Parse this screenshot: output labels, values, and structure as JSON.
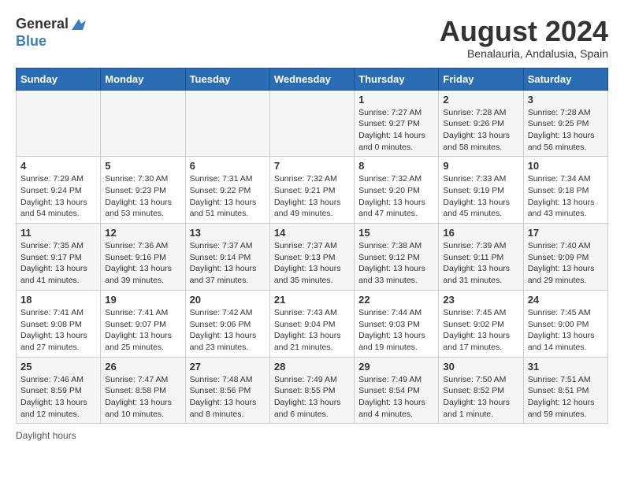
{
  "logo": {
    "line1": "General",
    "line2": "Blue"
  },
  "title": "August 2024",
  "location": "Benalauria, Andalusia, Spain",
  "days_header": [
    "Sunday",
    "Monday",
    "Tuesday",
    "Wednesday",
    "Thursday",
    "Friday",
    "Saturday"
  ],
  "weeks": [
    [
      {
        "day": "",
        "detail": ""
      },
      {
        "day": "",
        "detail": ""
      },
      {
        "day": "",
        "detail": ""
      },
      {
        "day": "",
        "detail": ""
      },
      {
        "day": "1",
        "detail": "Sunrise: 7:27 AM\nSunset: 9:27 PM\nDaylight: 14 hours\nand 0 minutes."
      },
      {
        "day": "2",
        "detail": "Sunrise: 7:28 AM\nSunset: 9:26 PM\nDaylight: 13 hours\nand 58 minutes."
      },
      {
        "day": "3",
        "detail": "Sunrise: 7:28 AM\nSunset: 9:25 PM\nDaylight: 13 hours\nand 56 minutes."
      }
    ],
    [
      {
        "day": "4",
        "detail": "Sunrise: 7:29 AM\nSunset: 9:24 PM\nDaylight: 13 hours\nand 54 minutes."
      },
      {
        "day": "5",
        "detail": "Sunrise: 7:30 AM\nSunset: 9:23 PM\nDaylight: 13 hours\nand 53 minutes."
      },
      {
        "day": "6",
        "detail": "Sunrise: 7:31 AM\nSunset: 9:22 PM\nDaylight: 13 hours\nand 51 minutes."
      },
      {
        "day": "7",
        "detail": "Sunrise: 7:32 AM\nSunset: 9:21 PM\nDaylight: 13 hours\nand 49 minutes."
      },
      {
        "day": "8",
        "detail": "Sunrise: 7:32 AM\nSunset: 9:20 PM\nDaylight: 13 hours\nand 47 minutes."
      },
      {
        "day": "9",
        "detail": "Sunrise: 7:33 AM\nSunset: 9:19 PM\nDaylight: 13 hours\nand 45 minutes."
      },
      {
        "day": "10",
        "detail": "Sunrise: 7:34 AM\nSunset: 9:18 PM\nDaylight: 13 hours\nand 43 minutes."
      }
    ],
    [
      {
        "day": "11",
        "detail": "Sunrise: 7:35 AM\nSunset: 9:17 PM\nDaylight: 13 hours\nand 41 minutes."
      },
      {
        "day": "12",
        "detail": "Sunrise: 7:36 AM\nSunset: 9:16 PM\nDaylight: 13 hours\nand 39 minutes."
      },
      {
        "day": "13",
        "detail": "Sunrise: 7:37 AM\nSunset: 9:14 PM\nDaylight: 13 hours\nand 37 minutes."
      },
      {
        "day": "14",
        "detail": "Sunrise: 7:37 AM\nSunset: 9:13 PM\nDaylight: 13 hours\nand 35 minutes."
      },
      {
        "day": "15",
        "detail": "Sunrise: 7:38 AM\nSunset: 9:12 PM\nDaylight: 13 hours\nand 33 minutes."
      },
      {
        "day": "16",
        "detail": "Sunrise: 7:39 AM\nSunset: 9:11 PM\nDaylight: 13 hours\nand 31 minutes."
      },
      {
        "day": "17",
        "detail": "Sunrise: 7:40 AM\nSunset: 9:09 PM\nDaylight: 13 hours\nand 29 minutes."
      }
    ],
    [
      {
        "day": "18",
        "detail": "Sunrise: 7:41 AM\nSunset: 9:08 PM\nDaylight: 13 hours\nand 27 minutes."
      },
      {
        "day": "19",
        "detail": "Sunrise: 7:41 AM\nSunset: 9:07 PM\nDaylight: 13 hours\nand 25 minutes."
      },
      {
        "day": "20",
        "detail": "Sunrise: 7:42 AM\nSunset: 9:06 PM\nDaylight: 13 hours\nand 23 minutes."
      },
      {
        "day": "21",
        "detail": "Sunrise: 7:43 AM\nSunset: 9:04 PM\nDaylight: 13 hours\nand 21 minutes."
      },
      {
        "day": "22",
        "detail": "Sunrise: 7:44 AM\nSunset: 9:03 PM\nDaylight: 13 hours\nand 19 minutes."
      },
      {
        "day": "23",
        "detail": "Sunrise: 7:45 AM\nSunset: 9:02 PM\nDaylight: 13 hours\nand 17 minutes."
      },
      {
        "day": "24",
        "detail": "Sunrise: 7:45 AM\nSunset: 9:00 PM\nDaylight: 13 hours\nand 14 minutes."
      }
    ],
    [
      {
        "day": "25",
        "detail": "Sunrise: 7:46 AM\nSunset: 8:59 PM\nDaylight: 13 hours\nand 12 minutes."
      },
      {
        "day": "26",
        "detail": "Sunrise: 7:47 AM\nSunset: 8:58 PM\nDaylight: 13 hours\nand 10 minutes."
      },
      {
        "day": "27",
        "detail": "Sunrise: 7:48 AM\nSunset: 8:56 PM\nDaylight: 13 hours\nand 8 minutes."
      },
      {
        "day": "28",
        "detail": "Sunrise: 7:49 AM\nSunset: 8:55 PM\nDaylight: 13 hours\nand 6 minutes."
      },
      {
        "day": "29",
        "detail": "Sunrise: 7:49 AM\nSunset: 8:54 PM\nDaylight: 13 hours\nand 4 minutes."
      },
      {
        "day": "30",
        "detail": "Sunrise: 7:50 AM\nSunset: 8:52 PM\nDaylight: 13 hours\nand 1 minute."
      },
      {
        "day": "31",
        "detail": "Sunrise: 7:51 AM\nSunset: 8:51 PM\nDaylight: 12 hours\nand 59 minutes."
      }
    ]
  ],
  "footer": "Daylight hours"
}
